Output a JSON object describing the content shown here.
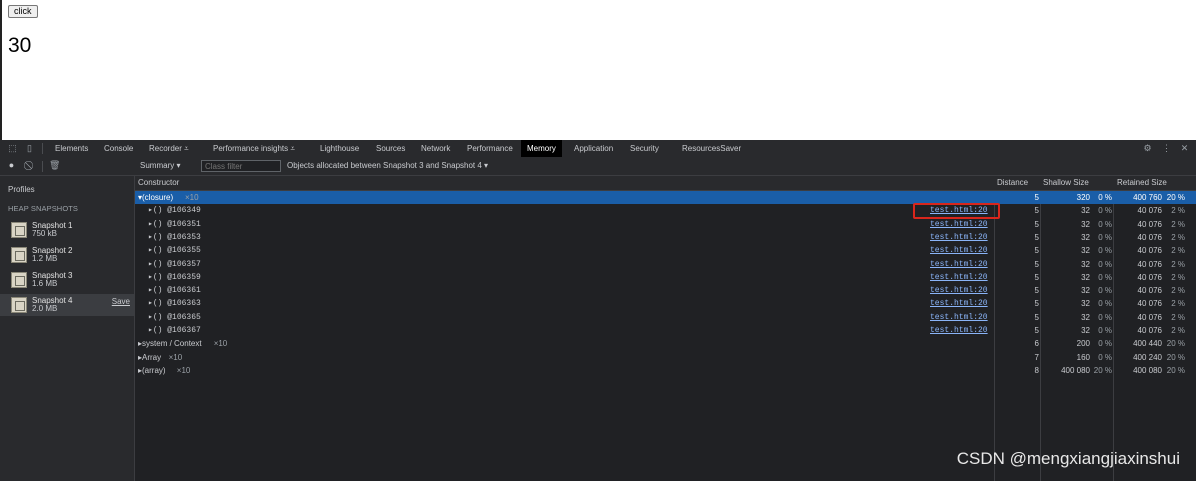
{
  "page": {
    "button_label": "click",
    "counter": "30"
  },
  "devtools": {
    "tabs": [
      "Elements",
      "Console",
      "Recorder ⩡",
      "Performance insights ⩡",
      "Lighthouse",
      "Sources",
      "Network",
      "Performance",
      "Memory",
      "Application",
      "Security",
      "ResourcesSaver"
    ],
    "toolbar": {
      "view": "Summary ▾",
      "class_filter_placeholder": "Class filter",
      "range": "Objects allocated between Snapshot 3 and Snapshot 4 ▾"
    },
    "sidebar": {
      "title": "Profiles",
      "section": "HEAP SNAPSHOTS",
      "snapshots": [
        {
          "name": "Snapshot 1",
          "size": "750 kB"
        },
        {
          "name": "Snapshot 2",
          "size": "1.2 MB"
        },
        {
          "name": "Snapshot 3",
          "size": "1.6 MB"
        },
        {
          "name": "Snapshot 4",
          "size": "2.0 MB",
          "save": "Save"
        }
      ]
    },
    "columns": {
      "constructor": "Constructor",
      "distance": "Distance",
      "shallow": "Shallow Size",
      "retained": "Retained Size"
    },
    "rows": [
      {
        "name": "▾(closure)",
        "count": "×10",
        "link": "",
        "distance": "5",
        "shallow": "320",
        "shallow_pct": "0 %",
        "retained": "400 760",
        "retained_pct": "20 %"
      },
      {
        "name": "▸() @106349",
        "count": "",
        "link": "test.html:20",
        "distance": "5",
        "shallow": "32",
        "shallow_pct": "0 %",
        "retained": "40 076",
        "retained_pct": "2 %"
      },
      {
        "name": "▸() @106351",
        "count": "",
        "link": "test.html:20",
        "distance": "5",
        "shallow": "32",
        "shallow_pct": "0 %",
        "retained": "40 076",
        "retained_pct": "2 %"
      },
      {
        "name": "▸() @106353",
        "count": "",
        "link": "test.html:20",
        "distance": "5",
        "shallow": "32",
        "shallow_pct": "0 %",
        "retained": "40 076",
        "retained_pct": "2 %"
      },
      {
        "name": "▸() @106355",
        "count": "",
        "link": "test.html:20",
        "distance": "5",
        "shallow": "32",
        "shallow_pct": "0 %",
        "retained": "40 076",
        "retained_pct": "2 %"
      },
      {
        "name": "▸() @106357",
        "count": "",
        "link": "test.html:20",
        "distance": "5",
        "shallow": "32",
        "shallow_pct": "0 %",
        "retained": "40 076",
        "retained_pct": "2 %"
      },
      {
        "name": "▸() @106359",
        "count": "",
        "link": "test.html:20",
        "distance": "5",
        "shallow": "32",
        "shallow_pct": "0 %",
        "retained": "40 076",
        "retained_pct": "2 %"
      },
      {
        "name": "▸() @106361",
        "count": "",
        "link": "test.html:20",
        "distance": "5",
        "shallow": "32",
        "shallow_pct": "0 %",
        "retained": "40 076",
        "retained_pct": "2 %"
      },
      {
        "name": "▸() @106363",
        "count": "",
        "link": "test.html:20",
        "distance": "5",
        "shallow": "32",
        "shallow_pct": "0 %",
        "retained": "40 076",
        "retained_pct": "2 %"
      },
      {
        "name": "▸() @106365",
        "count": "",
        "link": "test.html:20",
        "distance": "5",
        "shallow": "32",
        "shallow_pct": "0 %",
        "retained": "40 076",
        "retained_pct": "2 %"
      },
      {
        "name": "▸() @106367",
        "count": "",
        "link": "test.html:20",
        "distance": "5",
        "shallow": "32",
        "shallow_pct": "0 %",
        "retained": "40 076",
        "retained_pct": "2 %"
      },
      {
        "name": "▸system / Context",
        "count": "×10",
        "link": "",
        "distance": "6",
        "shallow": "200",
        "shallow_pct": "0 %",
        "retained": "400 440",
        "retained_pct": "20 %"
      },
      {
        "name": "▸Array",
        "count": "×10",
        "link": "",
        "distance": "7",
        "shallow": "160",
        "shallow_pct": "0 %",
        "retained": "400 240",
        "retained_pct": "20 %"
      },
      {
        "name": "▸(array)",
        "count": "×10",
        "link": "",
        "distance": "8",
        "shallow": "400 080",
        "shallow_pct": "20 %",
        "retained": "400 080",
        "retained_pct": "20 %"
      }
    ],
    "watermark": "CSDN @mengxiangjiaxinshui",
    "colors": {
      "panel": "#202124",
      "selected_row": "#1a5ea8",
      "highlight": "#d9261c",
      "link": "#8ab4f8"
    }
  }
}
